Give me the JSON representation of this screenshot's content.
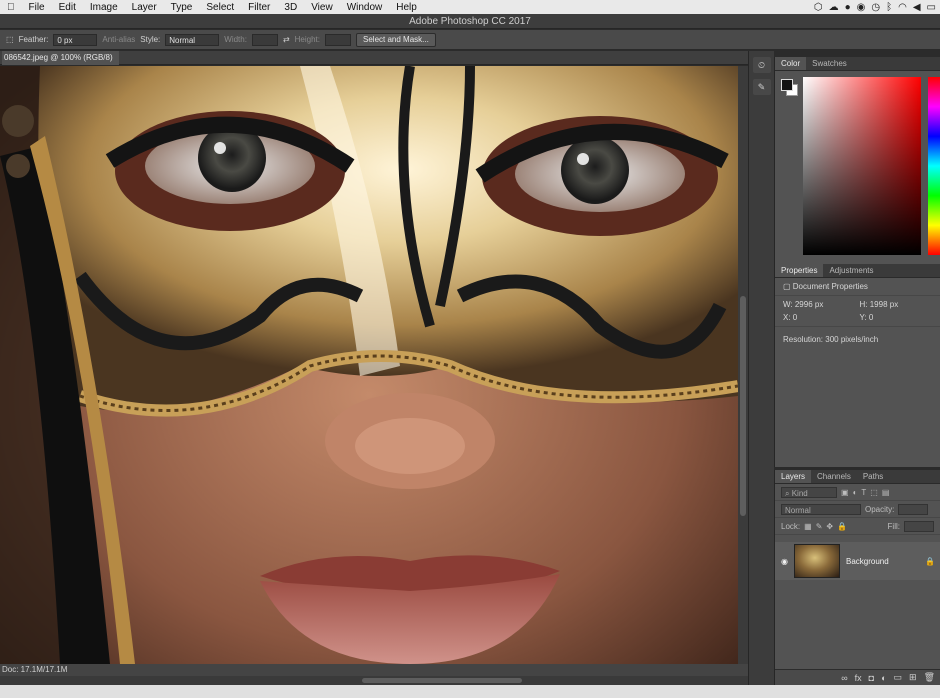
{
  "menu": {
    "apple": "",
    "items": [
      "File",
      "Edit",
      "Image",
      "Layer",
      "Type",
      "Select",
      "Filter",
      "3D",
      "View",
      "Window",
      "Help"
    ]
  },
  "tray": {
    "icons": [
      "dropbox-icon",
      "creative-cloud-icon",
      "record-icon",
      "evernote-icon",
      "clock-icon",
      "bluetooth-icon",
      "wifi-icon",
      "volume-icon",
      "battery-icon"
    ]
  },
  "title": "Adobe Photoshop CC 2017",
  "options": {
    "feather_label": "Feather:",
    "feather_value": "0 px",
    "antialias": "Anti-alias",
    "style_label": "Style:",
    "style_value": "Normal",
    "width_label": "Width:",
    "height_label": "Height:",
    "select_mask": "Select and Mask..."
  },
  "document": {
    "tab": "086542.jpeg @ 100% (RGB/8)",
    "status": "Doc: 17.1M/17.1M"
  },
  "color_panel": {
    "tabs": [
      "Color",
      "Swatches"
    ]
  },
  "properties_panel": {
    "tabs": [
      "Properties",
      "Adjustments"
    ],
    "header": "Document Properties",
    "w": "W: 2996 px",
    "h": "H: 1998 px",
    "x": "X: 0",
    "y": "Y: 0",
    "resolution": "Resolution: 300 pixels/inch"
  },
  "layers_panel": {
    "tabs": [
      "Layers",
      "Channels",
      "Paths"
    ],
    "kind": "Kind",
    "blend": "Normal",
    "opacity": "Opacity:",
    "lock": "Lock:",
    "fill": "Fill:",
    "layer_name": "Background"
  },
  "colors": {
    "panel": "#535353",
    "ui_dark": "#2b2b2b",
    "accent": "#ff0000"
  }
}
